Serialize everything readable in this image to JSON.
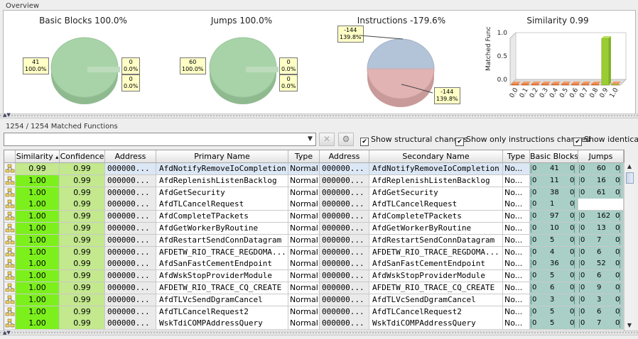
{
  "overview": {
    "title": "Overview",
    "charts": [
      {
        "title": "Basic Blocks 100.0%",
        "notes": [
          "41\n100.0%",
          "0\n0.0%",
          "0\n0.0%"
        ]
      },
      {
        "title": "Jumps 100.0%",
        "notes": [
          "60\n100.0%",
          "0\n0.0%",
          "0\n0.0%"
        ]
      },
      {
        "title": "Instructions -179.6%",
        "notes": [
          "-144\n139.8%",
          "-144\n139.8%"
        ]
      }
    ],
    "similarity_chart": {
      "title": "Similarity 0.99",
      "ylabel": "Matched Functions",
      "yticks": [
        "1.0",
        "0.5",
        "0.0"
      ],
      "xticks": [
        "0.0",
        "0.1",
        "0.2",
        "0.3",
        "0.4",
        "0.5",
        "0.6",
        "0.7",
        "0.8",
        "0.9",
        "1.0"
      ]
    }
  },
  "chart_data": {
    "type": "bar",
    "title": "Similarity 0.99",
    "ylabel": "Matched Functions",
    "categories": [
      "0.0",
      "0.1",
      "0.2",
      "0.3",
      "0.4",
      "0.5",
      "0.6",
      "0.7",
      "0.8",
      "0.9",
      "1.0"
    ],
    "values": [
      0,
      0,
      0,
      0,
      0,
      0,
      0,
      0,
      0,
      1.0,
      0
    ],
    "ylim": [
      0,
      1.0
    ]
  },
  "matched": {
    "title": "1254 / 1254 Matched Functions",
    "filter_value": "",
    "checkboxes": [
      {
        "label": "Show structural changes",
        "checked": true
      },
      {
        "label": "Show only instructions changed",
        "checked": true
      },
      {
        "label": "Show identical",
        "checked": true
      }
    ]
  },
  "table": {
    "headers": [
      "Similarity",
      "Confidence",
      "Address",
      "Primary Name",
      "Type",
      "Address",
      "Secondary Name",
      "Type",
      "Basic Blocks",
      "Jumps"
    ],
    "sort_indicator": "▴",
    "rows": [
      {
        "sim": "0.99",
        "conf": "0.99",
        "addr1": "000000...",
        "name1": "AfdNotifyRemoveIoCompletion",
        "type1": "Normal",
        "addr2": "000000...",
        "name2": "AfdNotifyRemoveIoCompletion",
        "type2": "No...",
        "bb": [
          "0",
          "41",
          "0"
        ],
        "jp": [
          "0",
          "60",
          "0"
        ]
      },
      {
        "sim": "1.00",
        "conf": "0.99",
        "addr1": "000000...",
        "name1": "AfdReplenishListenBacklog",
        "type1": "Normal",
        "addr2": "000000...",
        "name2": "AfdReplenishListenBacklog",
        "type2": "No...",
        "bb": [
          "0",
          "11",
          "0"
        ],
        "jp": [
          "0",
          "16",
          "0"
        ]
      },
      {
        "sim": "1.00",
        "conf": "0.99",
        "addr1": "000000...",
        "name1": "AfdGetSecurity",
        "type1": "Normal",
        "addr2": "000000...",
        "name2": "AfdGetSecurity",
        "type2": "No...",
        "bb": [
          "0",
          "38",
          "0"
        ],
        "jp": [
          "0",
          "61",
          "0"
        ]
      },
      {
        "sim": "1.00",
        "conf": "0.99",
        "addr1": "000000...",
        "name1": "AfdTLCancelRequest",
        "type1": "Normal",
        "addr2": "000000...",
        "name2": "AfdTLCancelRequest",
        "type2": "No...",
        "bb": [
          "0",
          "1",
          "0"
        ],
        "jp": [
          "",
          "",
          ""
        ]
      },
      {
        "sim": "1.00",
        "conf": "0.99",
        "addr1": "000000...",
        "name1": "AfdCompleteTPackets",
        "type1": "Normal",
        "addr2": "000000...",
        "name2": "AfdCompleteTPackets",
        "type2": "No...",
        "bb": [
          "0",
          "97",
          "0"
        ],
        "jp": [
          "0",
          "162",
          "0"
        ]
      },
      {
        "sim": "1.00",
        "conf": "0.99",
        "addr1": "000000...",
        "name1": "AfdGetWorkerByRoutine",
        "type1": "Normal",
        "addr2": "000000...",
        "name2": "AfdGetWorkerByRoutine",
        "type2": "No...",
        "bb": [
          "0",
          "10",
          "0"
        ],
        "jp": [
          "0",
          "13",
          "0"
        ]
      },
      {
        "sim": "1.00",
        "conf": "0.99",
        "addr1": "000000...",
        "name1": "AfdRestartSendConnDatagram",
        "type1": "Normal",
        "addr2": "000000...",
        "name2": "AfdRestartSendConnDatagram",
        "type2": "No...",
        "bb": [
          "0",
          "5",
          "0"
        ],
        "jp": [
          "0",
          "7",
          "0"
        ]
      },
      {
        "sim": "1.00",
        "conf": "0.99",
        "addr1": "000000...",
        "name1": "AFDETW_RIO_TRACE_REGDOMA...",
        "type1": "Normal",
        "addr2": "000000...",
        "name2": "AFDETW_RIO_TRACE_REGDOMA...",
        "type2": "No...",
        "bb": [
          "0",
          "4",
          "0"
        ],
        "jp": [
          "0",
          "6",
          "0"
        ]
      },
      {
        "sim": "1.00",
        "conf": "0.99",
        "addr1": "000000...",
        "name1": "AfdSanFastCementEndpoint",
        "type1": "Normal",
        "addr2": "000000...",
        "name2": "AfdSanFastCementEndpoint",
        "type2": "No...",
        "bb": [
          "0",
          "36",
          "0"
        ],
        "jp": [
          "0",
          "52",
          "0"
        ]
      },
      {
        "sim": "1.00",
        "conf": "0.99",
        "addr1": "000000...",
        "name1": "AfdWskStopProviderModule",
        "type1": "Normal",
        "addr2": "000000...",
        "name2": "AfdWskStopProviderModule",
        "type2": "No...",
        "bb": [
          "0",
          "5",
          "0"
        ],
        "jp": [
          "0",
          "6",
          "0"
        ]
      },
      {
        "sim": "1.00",
        "conf": "0.99",
        "addr1": "000000...",
        "name1": "AFDETW_RIO_TRACE_CQ_CREATE",
        "type1": "Normal",
        "addr2": "000000...",
        "name2": "AFDETW_RIO_TRACE_CQ_CREATE",
        "type2": "No...",
        "bb": [
          "0",
          "6",
          "0"
        ],
        "jp": [
          "0",
          "9",
          "0"
        ]
      },
      {
        "sim": "1.00",
        "conf": "0.99",
        "addr1": "000000...",
        "name1": "AfdTLVcSendDgramCancel",
        "type1": "Normal",
        "addr2": "000000...",
        "name2": "AfdTLVcSendDgramCancel",
        "type2": "No...",
        "bb": [
          "0",
          "3",
          "0"
        ],
        "jp": [
          "0",
          "3",
          "0"
        ]
      },
      {
        "sim": "1.00",
        "conf": "0.99",
        "addr1": "000000...",
        "name1": "AfdTLCancelRequest2",
        "type1": "Normal",
        "addr2": "000000...",
        "name2": "AfdTLCancelRequest2",
        "type2": "No...",
        "bb": [
          "0",
          "5",
          "0"
        ],
        "jp": [
          "0",
          "6",
          "0"
        ]
      },
      {
        "sim": "1.00",
        "conf": "0.99",
        "addr1": "000000...",
        "name1": "WskTdiCOMPAddressQuery",
        "type1": "Normal",
        "addr2": "000000...",
        "name2": "WskTdiCOMPAddressQuery",
        "type2": "No...",
        "bb": [
          "0",
          "5",
          "0"
        ],
        "jp": [
          "0",
          "7",
          "0"
        ]
      }
    ]
  },
  "colors": {
    "sim_099": "#c3e88e",
    "sim_100": "#7cf01c",
    "address_bg": "#eaeaea",
    "name_bg": "#ffffff",
    "selected_bg": "#dce7f5",
    "bb_bg": "#a9cfc7",
    "pie_green": "#a8d3a8",
    "pie_top_blue": "#b4c4d8",
    "pie_bottom_red": "#e2b3b3"
  }
}
